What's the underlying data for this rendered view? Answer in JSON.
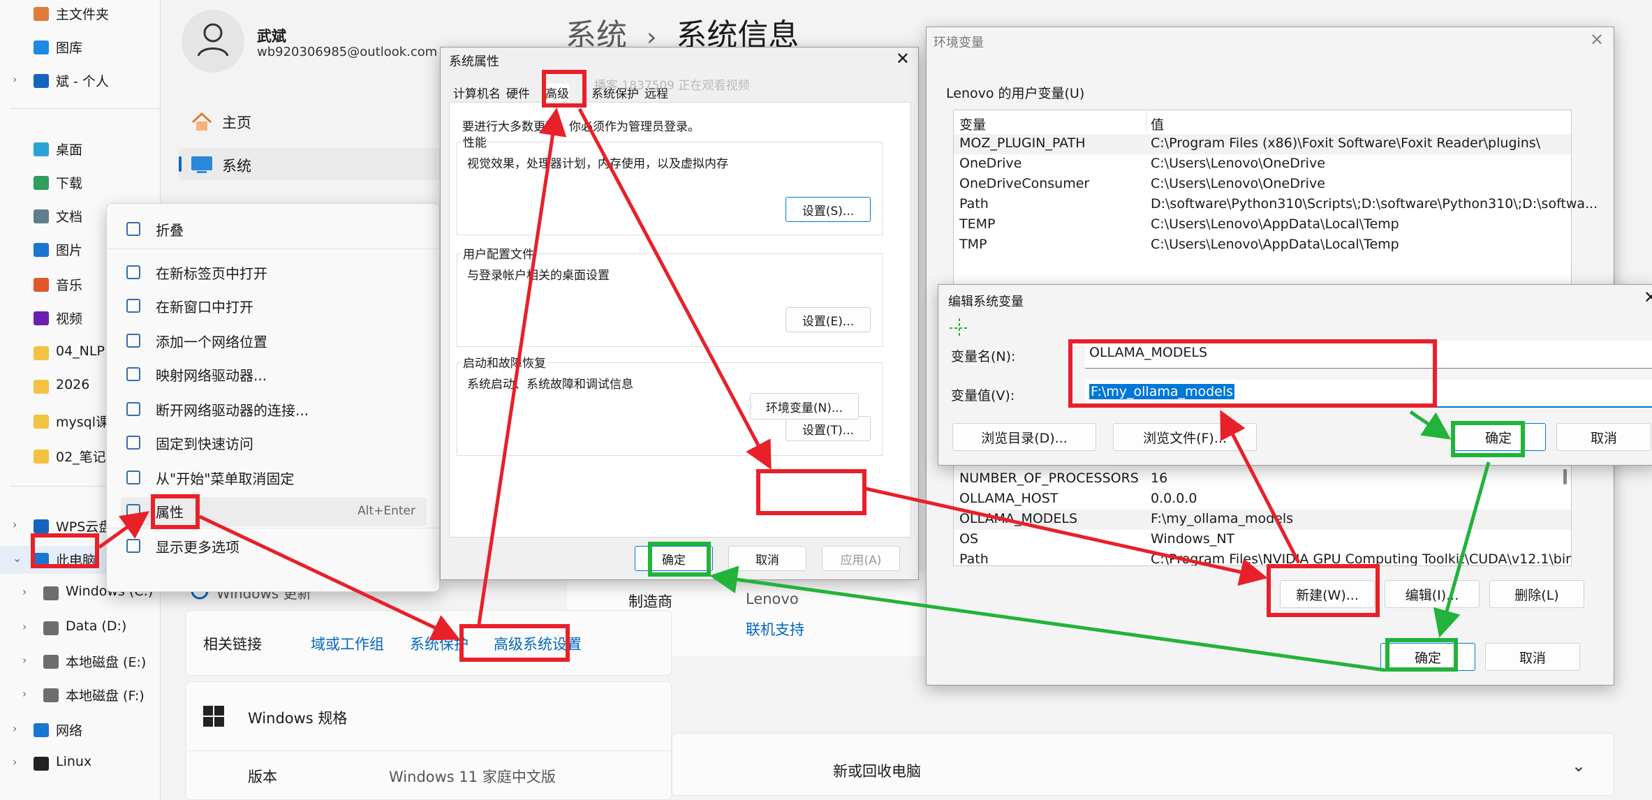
{
  "nav": {
    "items": [
      {
        "label": "主文件夹",
        "icon": "home-icon"
      },
      {
        "label": "图库",
        "icon": "gallery-icon"
      },
      {
        "label": "斌 - 个人",
        "icon": "cloud-icon"
      },
      {
        "label": "桌面",
        "icon": "desktop-icon"
      },
      {
        "label": "下载",
        "icon": "download-icon"
      },
      {
        "label": "文档",
        "icon": "document-icon"
      },
      {
        "label": "图片",
        "icon": "picture-icon"
      },
      {
        "label": "音乐",
        "icon": "music-icon"
      },
      {
        "label": "视频",
        "icon": "video-icon"
      },
      {
        "label": "04_NLP",
        "icon": "folder-icon"
      },
      {
        "label": "2026",
        "icon": "folder-icon"
      },
      {
        "label": "mysql课",
        "icon": "folder-icon"
      },
      {
        "label": "02_笔记",
        "icon": "folder-icon"
      },
      {
        "label": "WPS云盘",
        "icon": "cloud-icon"
      },
      {
        "label": "此电脑",
        "icon": "pc-icon"
      },
      {
        "label": "Windows (C:)",
        "icon": "drive-icon"
      },
      {
        "label": "Data (D:)",
        "icon": "drive-icon"
      },
      {
        "label": "本地磁盘 (E:)",
        "icon": "drive-icon"
      },
      {
        "label": "本地磁盘 (F:)",
        "icon": "drive-icon"
      },
      {
        "label": "网络",
        "icon": "network-icon"
      },
      {
        "label": "Linux",
        "icon": "linux-icon"
      }
    ],
    "partial_labels": [
      "NL",
      "5",
      "ql",
      "笥",
      "三",
      "脑"
    ]
  },
  "settings": {
    "user_name": "武斌",
    "user_email": "wb920306985@outlook.com",
    "breadcrumb_root": "系统",
    "breadcrumb_sep": "›",
    "breadcrumb_page": "系统信息",
    "nav_home": "主页",
    "nav_system": "系统",
    "windows_update": "Windows 更新",
    "manufacturer_label": "制造商",
    "manufacturer_value": "Lenovo",
    "support_link": "联机支持",
    "related_label": "相关链接",
    "link_domain": "域或工作组",
    "link_protection": "系统保护",
    "link_advanced": "高级系统设置",
    "spec_title": "Windows 规格",
    "version_label": "版本",
    "version_value": "Windows 11 家庭中文版",
    "reset_text": "新或回收电脑"
  },
  "context_menu": {
    "items": [
      {
        "label": "折叠",
        "icon": "collapse-icon"
      },
      {
        "label": "在新标签页中打开",
        "icon": "new-tab-icon"
      },
      {
        "label": "在新窗口中打开",
        "icon": "new-window-icon"
      },
      {
        "label": "添加一个网络位置",
        "icon": "network-location-icon"
      },
      {
        "label": "映射网络驱动器...",
        "icon": "map-drive-icon"
      },
      {
        "label": "断开网络驱动器的连接...",
        "icon": "disconnect-drive-icon"
      },
      {
        "label": "固定到快速访问",
        "icon": "pin-icon"
      },
      {
        "label": "从\"开始\"菜单取消固定",
        "icon": "unpin-icon"
      },
      {
        "label": "属性",
        "icon": "wrench-icon",
        "shortcut": "Alt+Enter"
      },
      {
        "label": "显示更多选项",
        "icon": "more-options-icon"
      }
    ]
  },
  "sysprop": {
    "title": "系统属性",
    "tabs": [
      "计算机名",
      "硬件",
      "高级",
      "系统保护",
      "远程"
    ],
    "admin_note": "要进行大多数更改，你必须作为管理员登录。",
    "overlay_note": "播客 1837509 正在观看视频",
    "perf_title": "性能",
    "perf_desc": "视觉效果，处理器计划，内存使用，以及虚拟内存",
    "profile_title": "用户配置文件",
    "profile_desc": "与登录帐户相关的桌面设置",
    "startup_title": "启动和故障恢复",
    "startup_desc": "系统启动、系统故障和调试信息",
    "settings_s": "设置(S)...",
    "settings_e": "设置(E)...",
    "settings_t": "设置(T)...",
    "env_button": "环境变量(N)...",
    "ok": "确定",
    "cancel": "取消",
    "apply": "应用(A)"
  },
  "envvars": {
    "title": "环境变量",
    "user_section": "Lenovo 的用户变量(U)",
    "col_var": "变量",
    "col_val": "值",
    "user_rows": [
      {
        "name": "MOZ_PLUGIN_PATH",
        "value": "C:\\Program Files (x86)\\Foxit Software\\Foxit Reader\\plugins\\"
      },
      {
        "name": "OneDrive",
        "value": "C:\\Users\\Lenovo\\OneDrive"
      },
      {
        "name": "OneDriveConsumer",
        "value": "C:\\Users\\Lenovo\\OneDrive"
      },
      {
        "name": "Path",
        "value": "D:\\software\\Python310\\Scripts\\;D:\\software\\Python310\\;D:\\softwa..."
      },
      {
        "name": "TEMP",
        "value": "C:\\Users\\Lenovo\\AppData\\Local\\Temp"
      },
      {
        "name": "TMP",
        "value": "C:\\Users\\Lenovo\\AppData\\Local\\Temp"
      }
    ],
    "system_rows": [
      {
        "name": "NUMBER_OF_PROCESSORS",
        "value": "16"
      },
      {
        "name": "OLLAMA_HOST",
        "value": "0.0.0.0"
      },
      {
        "name": "OLLAMA_MODELS",
        "value": "F:\\my_ollama_models"
      },
      {
        "name": "OS",
        "value": "Windows_NT"
      },
      {
        "name": "Path",
        "value": "C:\\Program Files\\NVIDIA GPU Computing Toolkit\\CUDA\\v12.1\\bin..."
      }
    ],
    "new_button": "新建(W)...",
    "edit_button": "编辑(I)...",
    "delete_button": "删除(L)",
    "ok": "确定",
    "cancel": "取消"
  },
  "editvar": {
    "title": "编辑系统变量",
    "name_label": "变量名(N):",
    "name_value": "OLLAMA_MODELS",
    "value_label": "变量值(V):",
    "value_value": "F:\\my_ollama_models",
    "browse_dir": "浏览目录(D)...",
    "browse_file": "浏览文件(F)...",
    "ok": "确定",
    "cancel": "取消"
  },
  "colors": {
    "annotation_red": "#e8202a",
    "annotation_green": "#22b33a",
    "accent": "#0067c0",
    "selection": "#0078d7"
  }
}
